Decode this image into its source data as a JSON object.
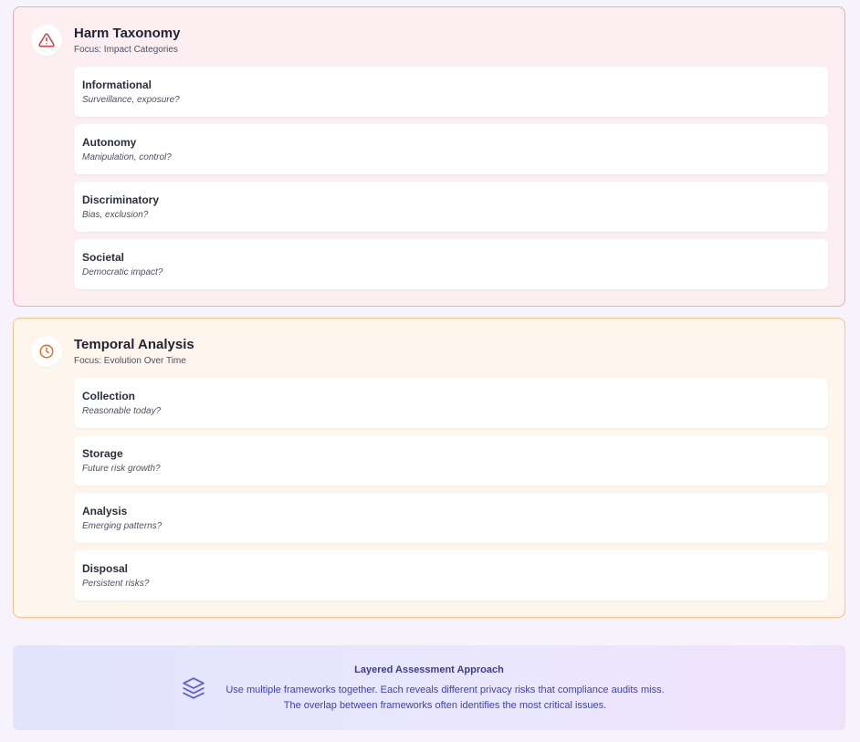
{
  "sections": [
    {
      "title": "Harm Taxonomy",
      "subtitle": "Focus: Impact Categories",
      "icon": "warning-triangle-icon",
      "accent": "#d93b3b",
      "items": [
        {
          "title": "Informational",
          "desc": "Surveillance, exposure?"
        },
        {
          "title": "Autonomy",
          "desc": "Manipulation, control?"
        },
        {
          "title": "Discriminatory",
          "desc": "Bias, exclusion?"
        },
        {
          "title": "Societal",
          "desc": "Democratic impact?"
        }
      ]
    },
    {
      "title": "Temporal Analysis",
      "subtitle": "Focus: Evolution Over Time",
      "icon": "clock-icon",
      "accent": "#e0712b",
      "items": [
        {
          "title": "Collection",
          "desc": "Reasonable today?"
        },
        {
          "title": "Storage",
          "desc": "Future risk growth?"
        },
        {
          "title": "Analysis",
          "desc": "Emerging patterns?"
        },
        {
          "title": "Disposal",
          "desc": "Persistent risks?"
        }
      ]
    }
  ],
  "banner": {
    "title": "Layered Assessment Approach",
    "text": "Use multiple frameworks together. Each reveals different privacy risks that compliance audits miss. The overlap between frameworks often identifies the most critical issues.",
    "icon": "layers-icon",
    "accent": "#5a5fd6"
  }
}
